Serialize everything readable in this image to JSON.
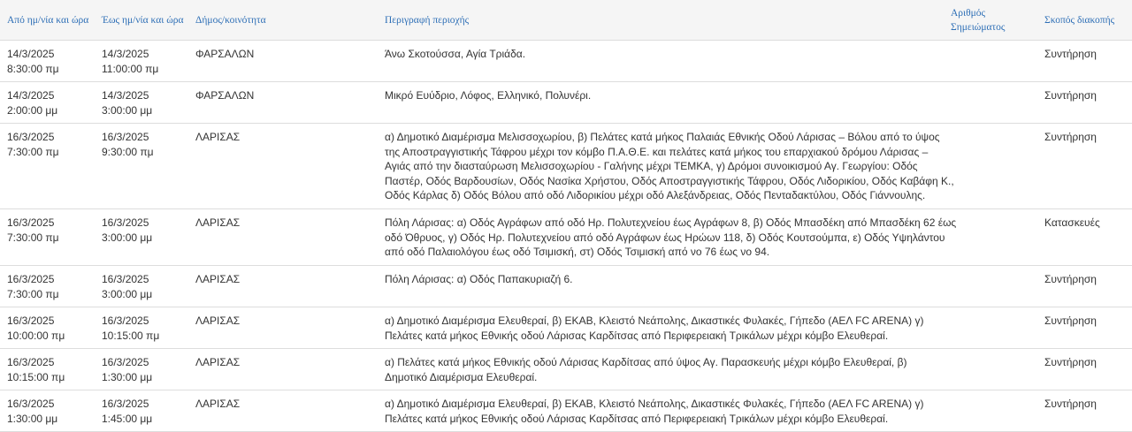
{
  "headers": {
    "from": "Από ημ/νία και ώρα",
    "to": "Έως ημ/νία και ώρα",
    "municipality": "Δήμος/κοινότητα",
    "description": "Περιγραφή περιοχής",
    "note_line1": "Αριθμός",
    "note_line2": "Σημειώματος",
    "purpose": "Σκοπός διακοπής"
  },
  "rows": [
    {
      "from_date": "14/3/2025",
      "from_time": "8:30:00 πμ",
      "to_date": "14/3/2025",
      "to_time": "11:00:00 πμ",
      "municipality": "ΦΑΡΣΑΛΩΝ",
      "description_lines": [
        "Άνω Σκοτούσσα, Αγία Τριάδα."
      ],
      "note": "",
      "purpose": "Συντήρηση"
    },
    {
      "from_date": "14/3/2025",
      "from_time": "2:00:00 μμ",
      "to_date": "14/3/2025",
      "to_time": "3:00:00 μμ",
      "municipality": "ΦΑΡΣΑΛΩΝ",
      "description_lines": [
        "Μικρό Ευύδριο, Λόφος, Ελληνικό, Πολυνέρι."
      ],
      "note": "",
      "purpose": "Συντήρηση"
    },
    {
      "from_date": "16/3/2025",
      "from_time": "7:30:00 πμ",
      "to_date": "16/3/2025",
      "to_time": "9:30:00 πμ",
      "municipality": "ΛΑΡΙΣΑΣ",
      "description_lines": [
        "α) Δημοτικό Διαμέρισμα Μελισσοχωρίου, β) Πελάτες κατά μήκος Παλαιάς Εθνικής Οδού Λάρισας – Βόλου από το ύψος",
        "της Αποστραγγιστικής Τάφρου μέχρι τον κόμβο Π.Α.Θ.Ε. και πελάτες κατά μήκος του επαρχιακού δρόμου Λάρισας –",
        "Αγιάς από την διασταύρωση Μελισσοχωρίου - Γαλήνης μέχρι ΤΕΜΚΑ, γ) Δρόμοι συνοικισμού Αγ. Γεωργίου: Οδός",
        "Παστέρ, Οδός Βαρδουσίων, Οδός Νασίκα Χρήστου, Οδός Αποστραγγιστικής Τάφρου, Οδός Λιδορικίου, Οδός Καβάφη Κ.,",
        "Οδός Κάρλας δ) Οδός Βόλου από οδό Λιδορικίου μέχρι οδό Αλεξάνδρειας, Οδός Πενταδακτύλου, Οδός Γιάννουλης."
      ],
      "note": "",
      "purpose": "Συντήρηση"
    },
    {
      "from_date": "16/3/2025",
      "from_time": "7:30:00 πμ",
      "to_date": "16/3/2025",
      "to_time": "3:00:00 μμ",
      "municipality": "ΛΑΡΙΣΑΣ",
      "description_lines": [
        "Πόλη Λάρισας: α) Οδός Αγράφων από οδό Ηρ. Πολυτεχνείου έως Αγράφων 8, β) Οδός Μπασδέκη από Μπασδέκη 62 έως",
        "οδό Όθρυος, γ) Οδός Ηρ. Πολυτεχνείου από οδό Αγράφων έως Ηρώων 118, δ) Οδός Κουτσούμπα, ε) Οδός Υψηλάντου",
        "από οδό Παλαιολόγου έως οδό Τσιμισκή, στ) Οδός Τσιμισκή από νο 76 έως νο 94."
      ],
      "note": "",
      "purpose": "Κατασκευές"
    },
    {
      "from_date": "16/3/2025",
      "from_time": "7:30:00 πμ",
      "to_date": "16/3/2025",
      "to_time": "3:00:00 μμ",
      "municipality": "ΛΑΡΙΣΑΣ",
      "description_lines": [
        "Πόλη Λάρισας: α) Οδός Παπακυριαζή 6."
      ],
      "note": "",
      "purpose": "Συντήρηση"
    },
    {
      "from_date": "16/3/2025",
      "from_time": "10:00:00 πμ",
      "to_date": "16/3/2025",
      "to_time": "10:15:00 πμ",
      "municipality": "ΛΑΡΙΣΑΣ",
      "description_lines": [
        "α) Δημοτικό Διαμέρισμα Ελευθεραί, β) ΕΚΑΒ, Κλειστό Νεάπολης, Δικαστικές Φυλακές, Γήπεδο (ΑΕΛ FC ARENA) γ)",
        "Πελάτες κατά μήκος Εθνικής οδού Λάρισας Καρδίτσας από Περιφερειακή Τρικάλων μέχρι κόμβο Ελευθεραί."
      ],
      "note": "",
      "purpose": "Συντήρηση"
    },
    {
      "from_date": "16/3/2025",
      "from_time": "10:15:00 πμ",
      "to_date": "16/3/2025",
      "to_time": "1:30:00 μμ",
      "municipality": "ΛΑΡΙΣΑΣ",
      "description_lines": [
        "α) Πελάτες κατά μήκος Εθνικής οδού Λάρισας Καρδίτσας από ύψος Αγ. Παρασκευής μέχρι κόμβο Ελευθεραί, β)",
        "Δημοτικό Διαμέρισμα Ελευθεραί."
      ],
      "note": "",
      "purpose": "Συντήρηση"
    },
    {
      "from_date": "16/3/2025",
      "from_time": "1:30:00 μμ",
      "to_date": "16/3/2025",
      "to_time": "1:45:00 μμ",
      "municipality": "ΛΑΡΙΣΑΣ",
      "description_lines": [
        "α) Δημοτικό Διαμέρισμα Ελευθεραί, β) ΕΚΑΒ, Κλειστό Νεάπολης, Δικαστικές Φυλακές, Γήπεδο (ΑΕΛ FC ARENA) γ)",
        "Πελάτες κατά μήκος Εθνικής οδού Λάρισας Καρδίτσας από Περιφερειακή Τρικάλων μέχρι κόμβο Ελευθεραί."
      ],
      "note": "",
      "purpose": "Συντήρηση"
    }
  ]
}
